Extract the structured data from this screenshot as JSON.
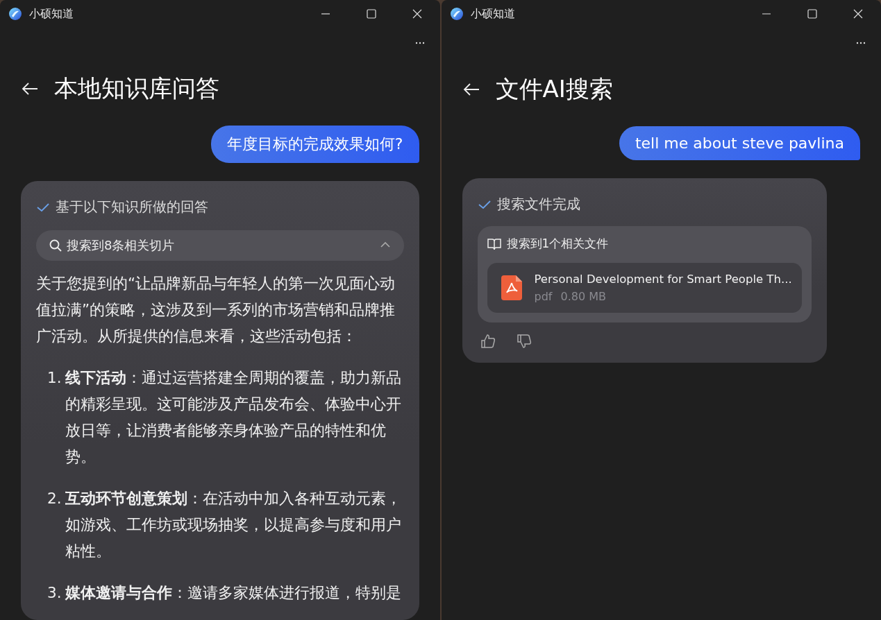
{
  "windows": [
    {
      "title": "小硕知道",
      "page_title": "本地知识库问答",
      "question": "年度目标的完成效果如何?",
      "answer": {
        "kind": "knowledge",
        "status": "基于以下知识所做的回答",
        "search": {
          "label": "搜索到8条相关切片",
          "expanded": true
        },
        "intro": "关于您提到的“让品牌新品与年轻人的第一次见面心动值拉满”的策略，这涉及到一系列的市场营销和品牌推广活动。从所提供的信息来看，这些活动包括：",
        "items": [
          {
            "number": "1.",
            "text": "**线下活动**：通过运营搭建全周期的覆盖，助力新品的精彩呈现。这可能涉及产品发布会、体验中心开放日等，让消费者能够亲身体验产品的特性和优势。"
          },
          {
            "number": "2.",
            "text": "**互动环节创意策划**：在活动中加入各种互动元素，如游戏、工作坊或现场抽奖，以提高参与度和用户粘性。"
          },
          {
            "number": "3.",
            "text": "**媒体邀请与合作**：邀请多家媒体进行报道，特别是"
          }
        ]
      }
    },
    {
      "title": "小硕知道",
      "page_title": "文件AI搜索",
      "question": "tell me about steve pavlina",
      "answer": {
        "kind": "files",
        "status": "搜索文件完成",
        "results_label": "搜索到1个相关文件",
        "files": [
          {
            "name": "Personal Development for Smart People Th...",
            "type": "pdf",
            "size": "0.80 MB"
          }
        ]
      }
    }
  ]
}
